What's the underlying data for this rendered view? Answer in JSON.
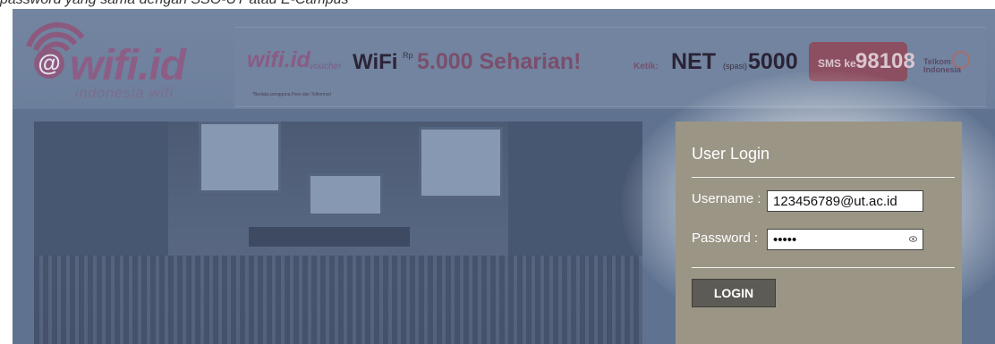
{
  "caption": "password yang sama dengan SSO-UT atau E-Campus",
  "logo": {
    "brand": "wifi.id",
    "at_symbol": "@",
    "wordmark": "wifi.id",
    "tagline": "indonesia wifi"
  },
  "banner": {
    "brand": "wifi.id",
    "voucher": "voucher",
    "product": "WiFi",
    "rp": "Rp",
    "price": "5.000 Seharian!",
    "ketik": "Ketik:",
    "net": "NET",
    "spasi": "(spasi)",
    "code": "5000",
    "sms_label": "SMS ke",
    "sms_number": "98108",
    "telkom": "Telkom Indonesia",
    "footnote": "*Berlaku pengguna Flexi dan Telkomsel"
  },
  "login": {
    "title": "User Login",
    "username_label": "Username :",
    "username_value": "123456789@ut.ac.id",
    "password_label": "Password :",
    "password_value": "•••••",
    "button": "LOGIN"
  },
  "colors": {
    "overlay": "#5f7391",
    "login_panel": "#9b9586",
    "button": "#5c5b55",
    "brand": "#8c5e86"
  },
  "icons": [
    "wifi-icon",
    "eye-icon"
  ]
}
